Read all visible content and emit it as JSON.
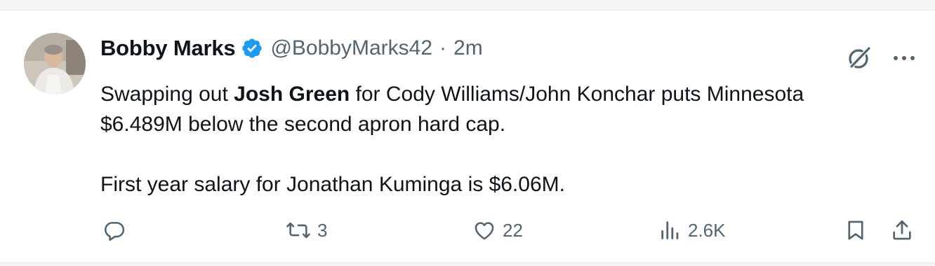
{
  "tweet": {
    "author": {
      "name": "Bobby Marks",
      "handle": "@BobbyMarks42",
      "separator": "·",
      "time": "2m",
      "verified": true
    },
    "text": {
      "line1_before": "Swapping out ",
      "line1_bold": "Josh Green",
      "line1_after": " for Cody Williams/John Konchar puts Minnesota",
      "line2": "$6.489M below the second apron hard cap.",
      "line3": "First year salary for Jonathan Kuminga is $6.06M."
    },
    "actions": {
      "reply": {
        "icon": "reply-icon",
        "count": ""
      },
      "retweet": {
        "icon": "retweet-icon",
        "count": "3"
      },
      "like": {
        "icon": "heart-icon",
        "count": "22"
      },
      "views": {
        "icon": "views-icon",
        "count": "2.6K"
      },
      "bookmark": {
        "icon": "bookmark-icon"
      },
      "share": {
        "icon": "share-icon"
      }
    },
    "header_icons": [
      "grok-icon",
      "more-icon"
    ],
    "colors": {
      "text": "#0f1419",
      "muted": "#536471",
      "verified": "#1d9bf0",
      "background": "#ffffff"
    }
  }
}
